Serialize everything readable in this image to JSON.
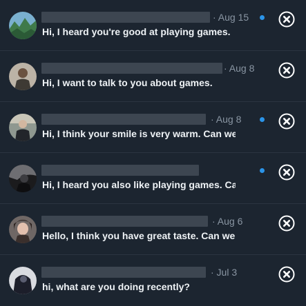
{
  "conversations": [
    {
      "date": "· Aug 15",
      "message": "Hi, I heard you're good at playing games.",
      "unread": true,
      "avatar": "landscape-photo"
    },
    {
      "date": "· Aug 8",
      "message": "Hi, I want to talk to you about games.",
      "unread": false,
      "avatar": "person-photo"
    },
    {
      "date": "· Aug 8",
      "message": "Hi, I think your smile is very warm. Can we",
      "unread": true,
      "avatar": "person-photo"
    },
    {
      "date": "",
      "message": "Hi, I heard you also like playing games. Can",
      "unread": true,
      "avatar": "dark-figure-photo"
    },
    {
      "date": "· Aug 6",
      "message": "Hello, I think you have great taste. Can we",
      "unread": false,
      "avatar": "person-photo"
    },
    {
      "date": "· Jul 3",
      "message": "hi, what are you doing recently?",
      "unread": false,
      "avatar": "dark-figure-photo"
    }
  ],
  "icons": {
    "close": "close-circle-icon",
    "unread": "unread-dot"
  },
  "colors": {
    "background": "#1c2530",
    "accent": "#2b94e8",
    "message_text": "#eef2f5",
    "date_text": "#8a96a3",
    "redacted_bar": "#3d4651"
  }
}
